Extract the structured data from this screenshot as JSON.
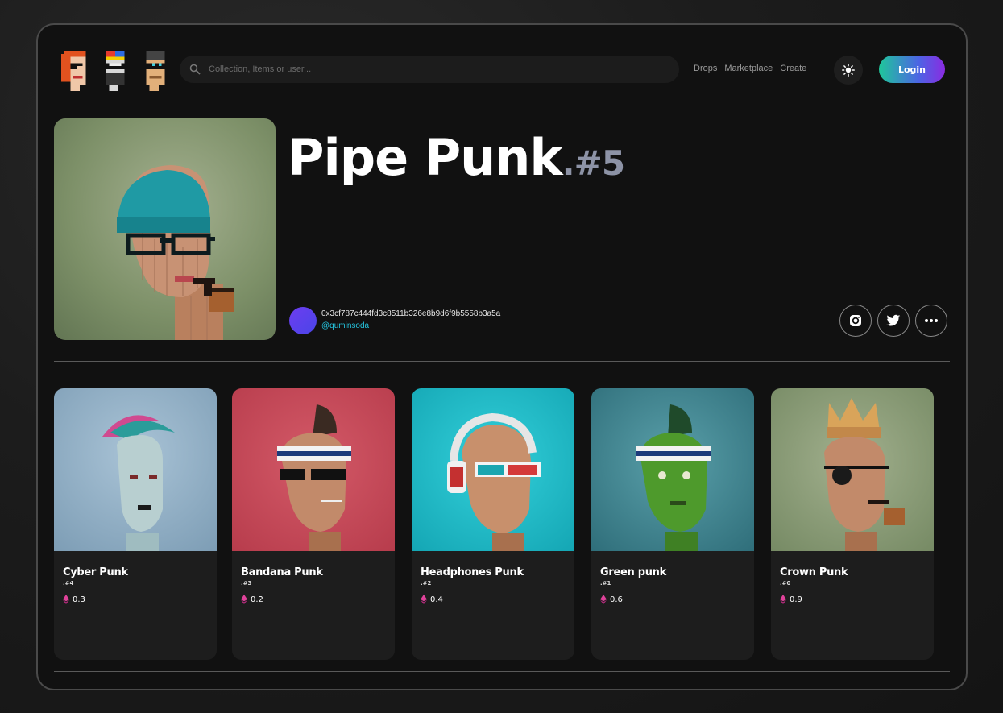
{
  "header": {
    "search_placeholder": "Collection, Items or user...",
    "nav": [
      "Drops",
      "Marketplace",
      "Create"
    ],
    "login_label": "Login"
  },
  "item": {
    "title": "Pipe Punk",
    "number": ".#5",
    "owner_address": "0x3cf787c444fd3c8511b326e8b9d6f9b5558b3a5a",
    "owner_handle": "@quminsoda"
  },
  "cards": [
    {
      "name": "Cyber Punk",
      "number": ".#4",
      "price": "0.3",
      "bg": "#8fb1c8"
    },
    {
      "name": "Bandana Punk",
      "number": ".#3",
      "price": "0.2",
      "bg": "#c94a5a"
    },
    {
      "name": "Headphones Punk",
      "number": ".#2",
      "price": "0.4",
      "bg": "#1fb5c4"
    },
    {
      "name": "Green punk",
      "number": ".#1",
      "price": "0.6",
      "bg": "#3f8a98"
    },
    {
      "name": "Crown Punk",
      "number": ".#0",
      "price": "0.9",
      "bg": "#8a9a78"
    }
  ],
  "colors": {
    "accent_gradient": [
      "#1fc79a",
      "#4c64e4",
      "#8a2be2"
    ],
    "handle": "#26c6e0",
    "eth_icon": "#e0429a"
  },
  "icons": [
    "punk-logo-1",
    "punk-logo-2",
    "punk-logo-3",
    "search-icon",
    "sun-icon",
    "instagram-icon",
    "twitter-icon",
    "more-icon",
    "eth-icon"
  ]
}
